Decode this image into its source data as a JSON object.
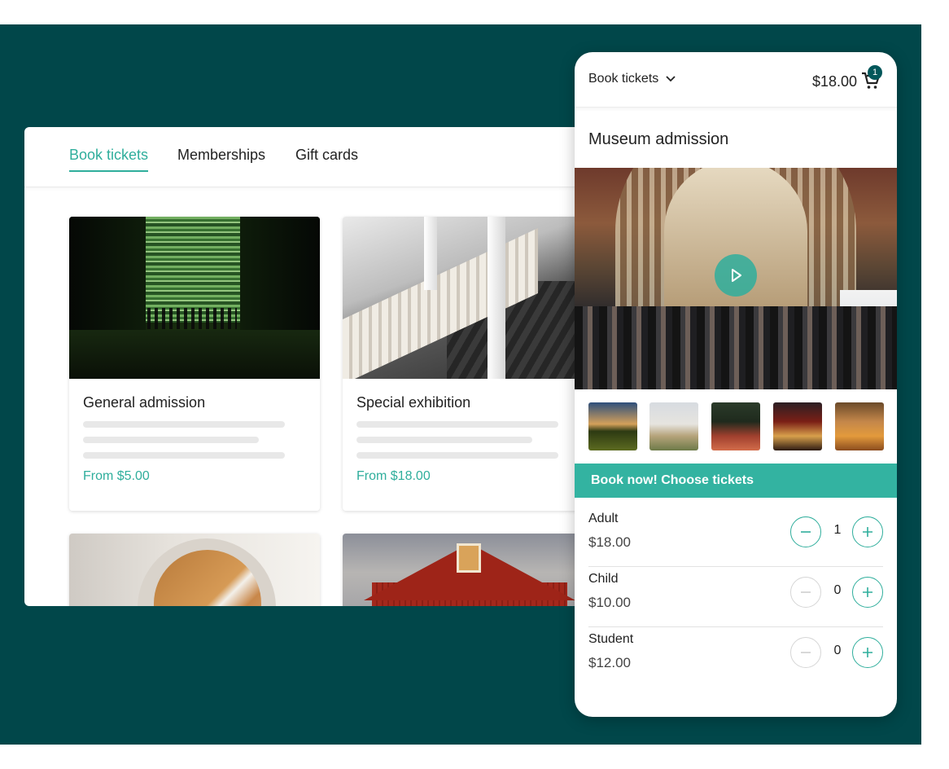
{
  "desktop": {
    "tabs": [
      {
        "label": "Book tickets",
        "active": true
      },
      {
        "label": "Memberships",
        "active": false
      },
      {
        "label": "Gift cards",
        "active": false
      }
    ],
    "cards": [
      {
        "title": "General admission",
        "price": "From $5.00"
      },
      {
        "title": "Special exhibition",
        "price": "From $18.00"
      }
    ]
  },
  "mobile": {
    "dropdown_label": "Book tickets",
    "cart_total": "$18.00",
    "cart_count": "1",
    "title": "Museum admission",
    "cta_label": "Book now! Choose tickets",
    "tickets": [
      {
        "name": "Adult",
        "price": "$18.00",
        "quantity": "1"
      },
      {
        "name": "Child",
        "price": "$10.00",
        "quantity": "0"
      },
      {
        "name": "Student",
        "price": "$12.00",
        "quantity": "0"
      }
    ]
  },
  "colors": {
    "background": "#01474a",
    "accent": "#2fae9c",
    "cta": "#33b3a1",
    "badge": "#01575a"
  },
  "icons": [
    "chevron-down-icon",
    "cart-icon",
    "play-icon",
    "minus-icon",
    "plus-icon"
  ]
}
